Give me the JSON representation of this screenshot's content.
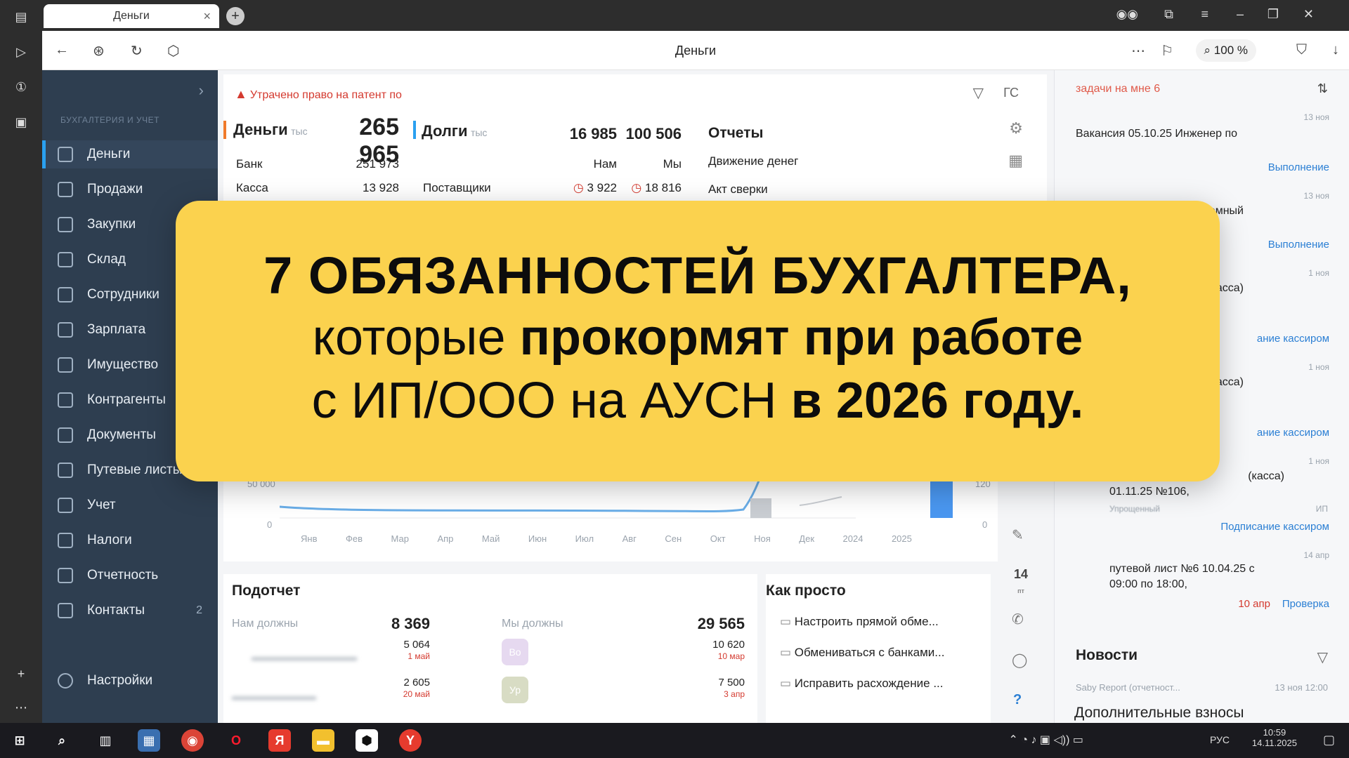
{
  "browser": {
    "tab_title": "Деньги",
    "url_title": "Деньги",
    "zoom": "100 %"
  },
  "sidebar": {
    "section_label": "БУХГАЛТЕРИЯ И УЧЕТ",
    "items": [
      {
        "label": "Деньги",
        "active": true
      },
      {
        "label": "Продажи"
      },
      {
        "label": "Закупки"
      },
      {
        "label": "Склад"
      },
      {
        "label": "Сотрудники"
      },
      {
        "label": "Зарплата"
      },
      {
        "label": "Имущество"
      },
      {
        "label": "Контрагенты"
      },
      {
        "label": "Документы"
      },
      {
        "label": "Путевые листы"
      },
      {
        "label": "Учет"
      },
      {
        "label": "Налоги"
      },
      {
        "label": "Отчетность"
      },
      {
        "label": "Контакты",
        "count": "2"
      }
    ],
    "settings_label": "Настройки"
  },
  "main": {
    "alert": "Утрачено право на патент по",
    "filter_label": "ГС",
    "money": {
      "title": "Деньги",
      "unit": "тыс",
      "total": "265 965",
      "bank_label": "Банк",
      "bank_value": "251 973",
      "cash_label": "Касса",
      "cash_value": "13 928"
    },
    "debts": {
      "title": "Долги",
      "unit": "тыс",
      "v1": "16 985",
      "v2": "100 506",
      "col1": "Нам",
      "col2": "Мы",
      "suppliers_label": "Поставщики",
      "s1": "3 922",
      "s2": "18 816"
    },
    "reports": {
      "title": "Отчеты",
      "items": [
        "Движение денег",
        "Акт сверки"
      ]
    },
    "chart": {
      "y_tick_1": "50 000",
      "y_tick_0": "0",
      "months": [
        "Янв",
        "Фев",
        "Мар",
        "Апр",
        "Май",
        "Июн",
        "Июл",
        "Авг",
        "Сен",
        "Окт",
        "Ноя",
        "Дек"
      ],
      "years": [
        "2024",
        "2025"
      ],
      "right_tick_1": "120",
      "right_tick_0": "0"
    },
    "advance": {
      "title": "Подотчет",
      "we_owed_label": "Нам должны",
      "we_owed_value": "8 369",
      "rows_left": [
        {
          "value": "5 064",
          "date": "1 май"
        },
        {
          "value": "2 605",
          "date": "20 май"
        }
      ],
      "we_owe_label": "Мы должны",
      "we_owe_value": "29 565",
      "rows_right": [
        {
          "avatar": "Во",
          "value": "10 620",
          "date": "10 мар"
        },
        {
          "avatar": "Ур",
          "value": "7 500",
          "date": "3 апр"
        }
      ]
    },
    "how_simple": {
      "title": "Как просто",
      "items": [
        "Настроить прямой обме...",
        "Обмениваться с банками...",
        "Исправить расхождение ..."
      ]
    },
    "side_day": "14",
    "side_day_sub": "пт"
  },
  "right_panel": {
    "header": "задачи на мне 6",
    "tasks": [
      {
        "date": "13 ноя",
        "text": "Вакансия 05.10.25 Инженер по",
        "status": "Выполнение"
      },
      {
        "date": "13 ноя",
        "text": "темный",
        "status": "Выполнение"
      },
      {
        "date": "1 ноя",
        "text": "(касса)",
        "status": "ание кассиром"
      },
      {
        "date": "1 ноя",
        "text": "(касса)",
        "status": "ание кассиром"
      },
      {
        "date": "1 ноя",
        "text": "(касса)",
        "sub": "01.11.25 №106,",
        "sub2": "Упрощенный",
        "tag": "ИП",
        "status": "Подписание кассиром"
      },
      {
        "date": "14 апр",
        "text": "путевой лист №6 10.04.25 с",
        "sub": "09:00 по 18:00,",
        "due": "10 апр",
        "status": "Проверка"
      }
    ],
    "news_title": "Новости",
    "news_source": "Saby Report (отчетност...",
    "news_time": "13 ноя 12:00",
    "news_headline": "Дополнительные взносы"
  },
  "banner": {
    "line1": "7 ОБЯЗАННОСТЕЙ БУХГАЛТЕРА,",
    "line2_regular": "которые ",
    "line2_bold": "прокормят при работе",
    "line3_regular": "с ИП/ООО на АУСН ",
    "line3_bold": "в 2026 году."
  },
  "taskbar": {
    "lang": "РУС",
    "time": "10:59",
    "date": "14.11.2025"
  },
  "colors": {
    "banner_bg": "#fbd24e",
    "sidebar_bg": "#2e3e50",
    "accent": "#2aa0f0",
    "alert": "#d43a2f"
  }
}
